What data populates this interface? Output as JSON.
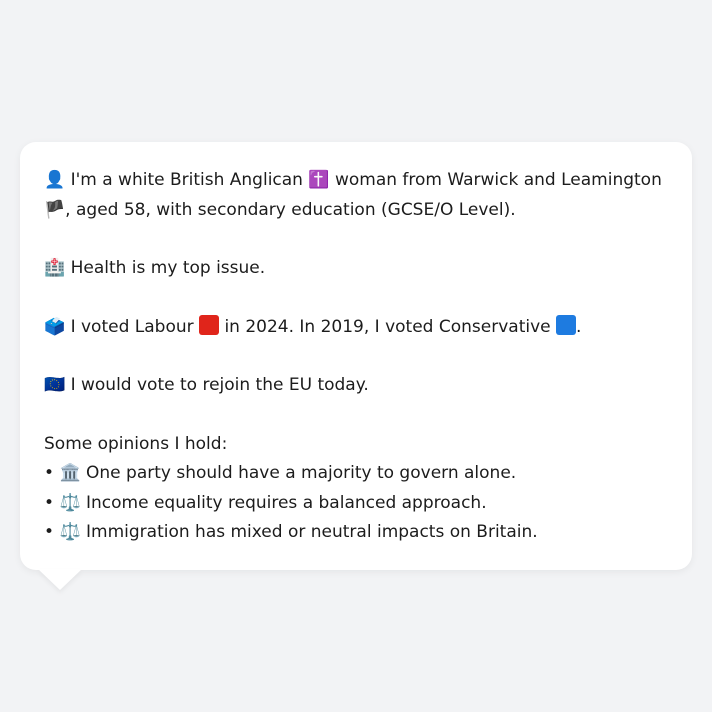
{
  "persona": {
    "intro_icon": "👤",
    "intro_a": "I'm a white British Anglican",
    "religion_icon": "✝️",
    "intro_b": "woman from Warwick and Leamington",
    "flag_icon": "🏴",
    "intro_c": ", aged 58, with secondary education (GCSE/O Level).",
    "health_icon": "🏥",
    "health_text": "Health is my top issue.",
    "vote_icon": "🗳️",
    "vote_a": "I voted Labour",
    "labour_color": "#e0251b",
    "vote_b": "in 2024. In 2019, I voted Conservative",
    "conservative_color": "#1e7be0",
    "vote_c": ".",
    "eu_icon": "🇪🇺",
    "eu_text": "I would vote to rejoin the EU today.",
    "opinions_heading": "Some opinions I hold:",
    "opinions": [
      {
        "bullet": "•",
        "icon": "🏛️",
        "text": "One party should have a majority to govern alone."
      },
      {
        "bullet": "•",
        "icon": "⚖️",
        "text": "Income equality requires a balanced approach."
      },
      {
        "bullet": "•",
        "icon": "⚖️",
        "text": "Immigration has mixed or neutral impacts on Britain."
      }
    ]
  }
}
